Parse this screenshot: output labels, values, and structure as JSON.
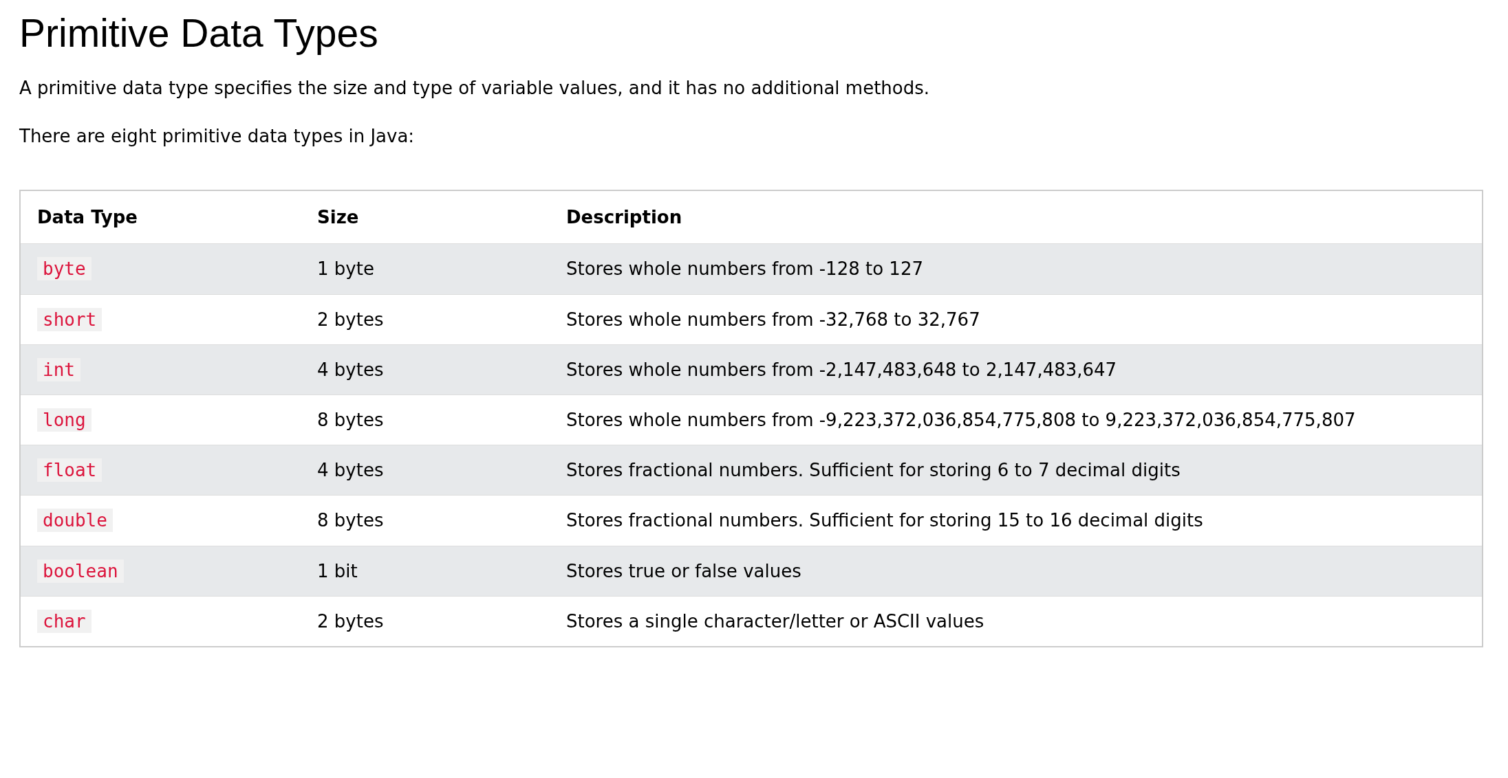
{
  "title": "Primitive Data Types",
  "paragraphs": [
    "A primitive data type specifies the size and type of variable values, and it has no additional methods.",
    "There are eight primitive data types in Java:"
  ],
  "table": {
    "columns": [
      "Data Type",
      "Size",
      "Description"
    ],
    "rows": [
      {
        "type": "byte",
        "size": "1 byte",
        "description": "Stores whole numbers from -128 to 127"
      },
      {
        "type": "short",
        "size": "2 bytes",
        "description": "Stores whole numbers from -32,768 to 32,767"
      },
      {
        "type": "int",
        "size": "4 bytes",
        "description": "Stores whole numbers from -2,147,483,648 to 2,147,483,647"
      },
      {
        "type": "long",
        "size": "8 bytes",
        "description": "Stores whole numbers from -9,223,372,036,854,775,808 to 9,223,372,036,854,775,807"
      },
      {
        "type": "float",
        "size": "4 bytes",
        "description": "Stores fractional numbers. Sufficient for storing 6 to 7 decimal digits"
      },
      {
        "type": "double",
        "size": "8 bytes",
        "description": "Stores fractional numbers. Sufficient for storing 15 to 16 decimal digits"
      },
      {
        "type": "boolean",
        "size": "1 bit",
        "description": "Stores true or false values"
      },
      {
        "type": "char",
        "size": "2 bytes",
        "description": "Stores a single character/letter or ASCII values"
      }
    ]
  }
}
